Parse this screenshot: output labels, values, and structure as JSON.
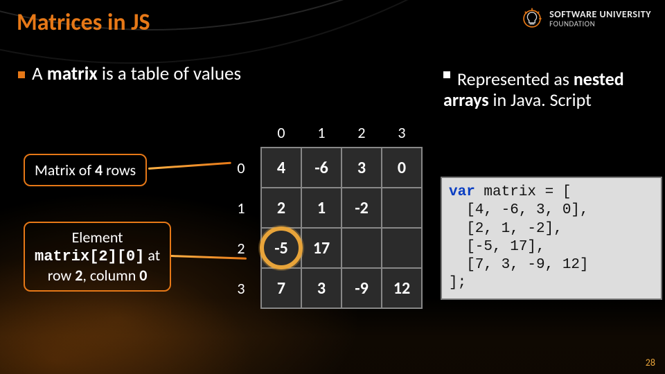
{
  "title": "Matrices in JS",
  "logo": {
    "line1": "SOFTWARE UNIVERSITY",
    "line2": "FOUNDATION"
  },
  "bullet_main": {
    "pre": "A ",
    "b": "matrix",
    "post": " is a table of values"
  },
  "bullet_right": {
    "pre": "Represented as ",
    "b": "nested arrays",
    "post": " in Java. Script"
  },
  "callout1": {
    "pre": "Matrix of ",
    "b": "4",
    "post": " rows"
  },
  "callout2": {
    "l1a": "Element",
    "code": "matrix[2][0]",
    "l2b": " at",
    "l3": "row ",
    "b2": "2",
    "mid": ", column ",
    "b3": "0"
  },
  "matrix": {
    "col_headers": [
      "0",
      "1",
      "2",
      "3"
    ],
    "row_headers": [
      "0",
      "1",
      "2",
      "3"
    ],
    "rows": [
      [
        "4",
        "-6",
        "3",
        "0"
      ],
      [
        "2",
        "1",
        "-2",
        ""
      ],
      [
        "-5",
        "17",
        "",
        ""
      ],
      [
        "7",
        "3",
        "-9",
        "12"
      ]
    ]
  },
  "code": {
    "kw": "var",
    "l1": " matrix = [",
    "l2": "  [4, -6, 3, 0],",
    "l3": "  [2, 1, -2],",
    "l4": "  [-5, 17],",
    "l5": "  [7, 3, -9, 12]",
    "l6": "];"
  },
  "page_number": "28"
}
